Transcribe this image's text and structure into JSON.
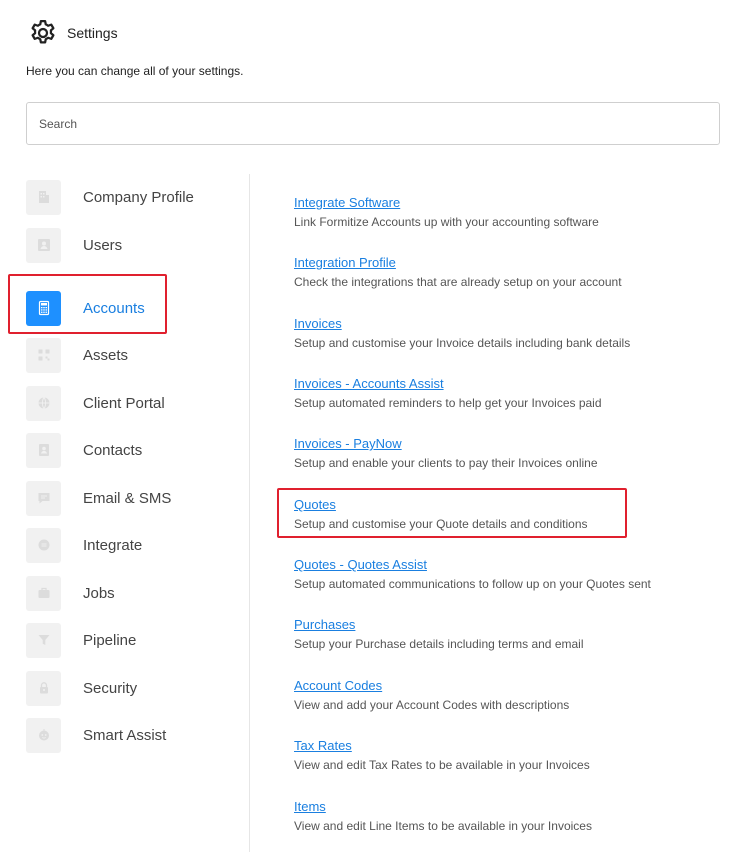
{
  "header": {
    "title": "Settings",
    "subtitle": "Here you can change all of your settings.",
    "icon": "gear-icon"
  },
  "search": {
    "placeholder": "Search",
    "value": ""
  },
  "accent_color": "#1e90ff",
  "highlight_color": "#e0202e",
  "sidebar": {
    "items": [
      {
        "label": "Company Profile",
        "icon": "building-icon",
        "active": false
      },
      {
        "label": "Users",
        "icon": "user-card-icon",
        "active": false
      },
      {
        "label": "Accounts",
        "icon": "calculator-icon",
        "active": true
      },
      {
        "label": "Assets",
        "icon": "qr-code-icon",
        "active": false
      },
      {
        "label": "Client Portal",
        "icon": "globe-icon",
        "active": false
      },
      {
        "label": "Contacts",
        "icon": "contact-card-icon",
        "active": false
      },
      {
        "label": "Email & SMS",
        "icon": "message-icon",
        "active": false
      },
      {
        "label": "Integrate",
        "icon": "plug-icon",
        "active": false
      },
      {
        "label": "Jobs",
        "icon": "briefcase-icon",
        "active": false
      },
      {
        "label": "Pipeline",
        "icon": "funnel-icon",
        "active": false
      },
      {
        "label": "Security",
        "icon": "lock-icon",
        "active": false
      },
      {
        "label": "Smart Assist",
        "icon": "assistant-icon",
        "active": false
      }
    ]
  },
  "settings": {
    "items": [
      {
        "title": "Integrate Software",
        "description": "Link Formitize Accounts up with your accounting software"
      },
      {
        "title": "Integration Profile",
        "description": "Check the integrations that are already setup on your account"
      },
      {
        "title": "Invoices",
        "description": "Setup and customise your Invoice details including bank details"
      },
      {
        "title": "Invoices - Accounts Assist",
        "description": "Setup automated reminders to help get your Invoices paid"
      },
      {
        "title": "Invoices - PayNow",
        "description": "Setup and enable your clients to pay their Invoices online"
      },
      {
        "title": "Quotes",
        "description": "Setup and customise your Quote details and conditions"
      },
      {
        "title": "Quotes - Quotes Assist",
        "description": "Setup automated communications to follow up on your Quotes sent"
      },
      {
        "title": "Purchases",
        "description": "Setup your Purchase details including terms and email"
      },
      {
        "title": "Account Codes",
        "description": "View and add your Account Codes with descriptions"
      },
      {
        "title": "Tax Rates",
        "description": "View and edit Tax Rates to be available in your Invoices"
      },
      {
        "title": "Items",
        "description": "View and edit Line Items to be available in your Invoices"
      }
    ]
  }
}
